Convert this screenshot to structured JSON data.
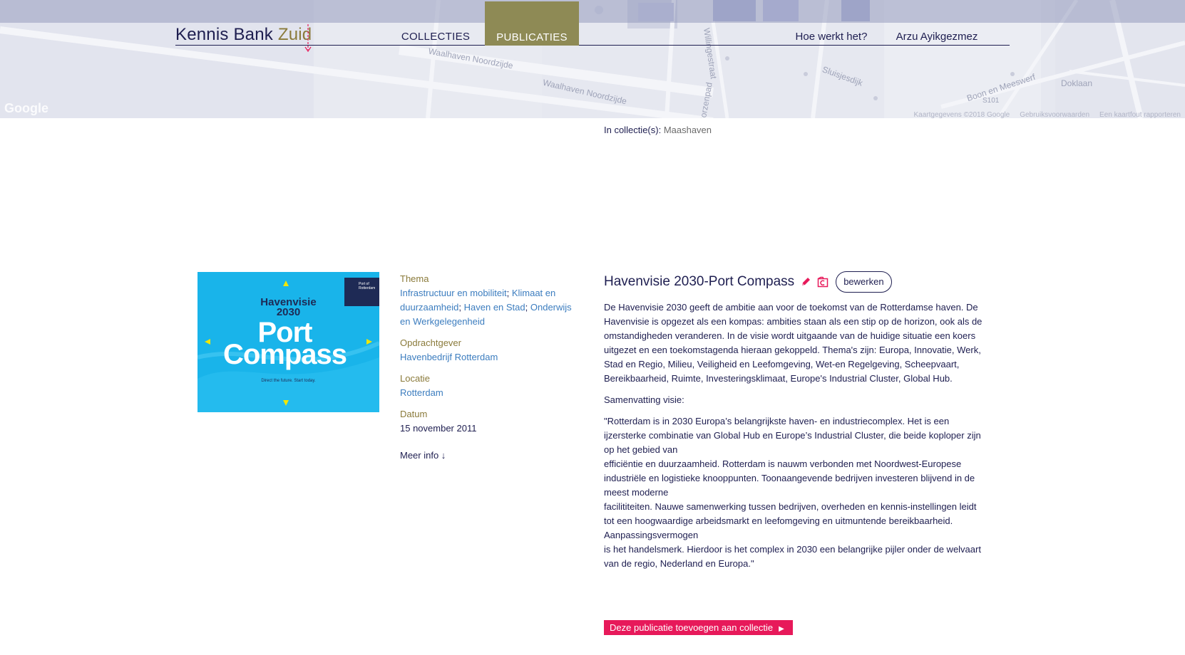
{
  "map": {
    "watermark": "Google",
    "streets": [
      "Waalhaven Noordzijde",
      "Waalhaven Noordzijde",
      "Willingestraat",
      "Gorzenpad",
      "Sluisjesdijk",
      "Boon en Meeswerf",
      "Doklaan",
      "S101"
    ],
    "footer": [
      "Kaartgegevens ©2018 Google",
      "Gebruiksvoorwaarden",
      "Een kaartfout rapporteren"
    ]
  },
  "nav": {
    "logo_main": "Kennis Bank ",
    "logo_accent": "Zuid",
    "collecties": "COLLECTIES",
    "publicaties": "PUBLICATIES",
    "hoe_werkt": "Hoe werkt het?",
    "user": "Arzu Ayikgezmez"
  },
  "collections": {
    "label": "In collectie(s): ",
    "value": "Maashaven"
  },
  "cover": {
    "title_small_1": "Havenvisie",
    "title_small_2": "2030",
    "title_big_1": "Port",
    "title_big_2": "Compass",
    "slogan": "Direct the future. Start today.",
    "logo_text": "Port of Rotterdam"
  },
  "meta": {
    "thema_label": "Thema",
    "thema_links": [
      "Infrastructuur en mobiliteit",
      "Klimaat en duurzaamheid",
      "Haven en Stad",
      "Onderwijs en Werkgelegenheid"
    ],
    "opdrachtgever_label": "Opdrachtgever",
    "opdrachtgever_value": "Havenbedrijf Rotterdam",
    "locatie_label": "Locatie",
    "locatie_value": "Rotterdam",
    "datum_label": "Datum",
    "datum_value": "15 november 2011",
    "meer_info": "Meer info ↓"
  },
  "publication": {
    "title": "Havenvisie 2030-Port Compass",
    "edit_button": "bewerken",
    "paragraph_1": "De Havenvisie 2030 geeft de ambitie aan voor de toekomst van de Rotterdamse haven. De Havenvisie is opgezet als een kompas: ambities staan als een stip op de horizon, ook als de omstandigheden veranderen. In de visie wordt uitgaande van de huidige situatie een koers uitgezet en een toekomstagenda hieraan gekoppeld. Thema's zijn: Europa, Innovatie, Werk, Stad en Regio, Milieu, Veiligheid en Leefomgeving, Wet-en Regelgeving, Scheepvaart, Bereikbaarheid, Ruimte, Investeringsklimaat, Europe's Industrial Cluster, Global Hub.",
    "paragraph_2": "Samenvatting visie:",
    "paragraph_3_1": "\"Rotterdam is in 2030 Europa’s belangrijkste haven- en industriecomplex. Het is een ijzersterke combinatie van Global Hub en Europe’s Industrial Cluster, die beide koploper zijn op het gebied van",
    "paragraph_3_2": "efficiëntie en duurzaamheid. Rotterdam is nauwm verbonden met Noordwest-Europese industriële en logistieke knooppunten. Toonaangevende bedrijven investeren blijvend in de meest moderne",
    "paragraph_3_3": "facilititeiten. Nauwe samenwerking tussen bedrijven, overheden en kennis-instellingen leidt tot een hoogwaardige arbeidsmarkt en leefomgeving en uitmuntende bereikbaarheid. Aanpassingsvermogen",
    "paragraph_3_4": "is het handelsmerk. Hierdoor is het complex in 2030 een belangrijke pijler onder de welvaart van de regio, Nederland en Europa.\"",
    "add_to_collection": "Deze publicatie toevoegen aan collectie"
  },
  "icons": {
    "edit": "pencil-icon",
    "collection": "collection-icon",
    "add_arrow": "play-arrow-icon"
  },
  "colors": {
    "navy": "#1e1e50",
    "olive": "#8a7a3a",
    "nav_active": "#8e8a55",
    "link": "#3c7dbf",
    "accent_pink": "#e7195a",
    "cover_blue": "#19b4ea"
  }
}
